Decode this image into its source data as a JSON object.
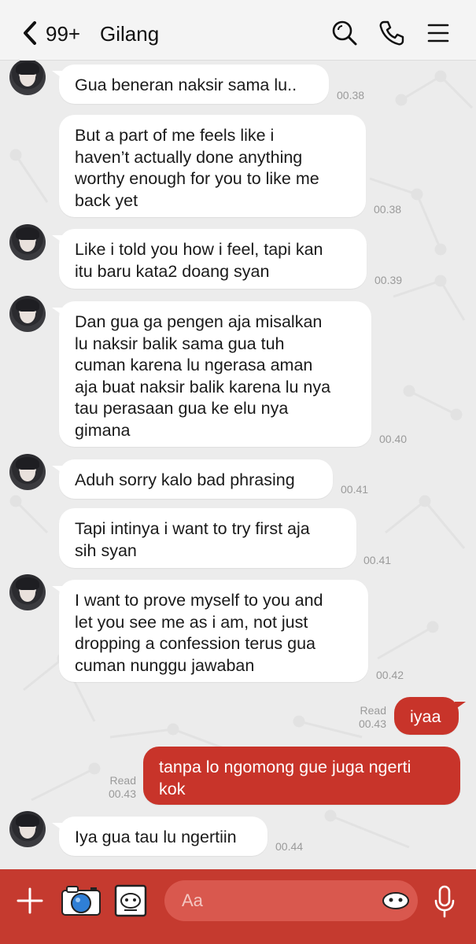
{
  "header": {
    "unread_badge": "99+",
    "contact_name": "Gilang"
  },
  "messages": [
    {
      "from": "other",
      "text": "Gua beneran naksir sama lu..",
      "time": "00.38"
    },
    {
      "from": "other",
      "text": "But a part of me feels like i\nhaven’t actually done anything\nworthy enough for you to like me\nback yet",
      "time": "00.38"
    },
    {
      "from": "other",
      "text": "Like i told you how i feel, tapi kan\nitu baru kata2 doang syan",
      "time": "00.39"
    },
    {
      "from": "other",
      "text": "Dan gua ga pengen aja misalkan\nlu naksir balik sama gua tuh\ncuman karena lu ngerasa aman\naja buat naksir balik karena lu nya\ntau perasaan gua ke elu nya\ngimana",
      "time": "00.40"
    },
    {
      "from": "other",
      "text": "Aduh sorry kalo bad phrasing",
      "time": "00.41"
    },
    {
      "from": "other",
      "text": "Tapi intinya i want to try first aja\nsih syan",
      "time": "00.41"
    },
    {
      "from": "other",
      "text": "I want to prove myself to you and\nlet you see me as i am, not just\ndropping a confession terus gua\ncuman nunggu jawaban",
      "time": "00.42"
    },
    {
      "from": "me",
      "text": "iyaa",
      "status": "Read",
      "time": "00.43"
    },
    {
      "from": "me",
      "text": "tanpa lo ngomong gue juga ngerti\nkok",
      "status": "Read",
      "time": "00.43"
    },
    {
      "from": "other",
      "text": "Iya gua tau lu ngertiin",
      "time": "00.44"
    }
  ],
  "composer": {
    "placeholder": "Aa"
  },
  "colors": {
    "accent": "#c8342a",
    "bottom_bar": "#c53a2f",
    "bubble_other": "#ffffff",
    "chat_bg": "#ececec"
  },
  "icons": {
    "back": "chevron-left-icon",
    "search": "search-icon",
    "call": "phone-icon",
    "menu": "menu-icon",
    "add": "plus-icon",
    "camera": "camera-icon",
    "gallery": "image-sticker-icon",
    "emoji": "emoji-icon",
    "mic": "microphone-icon"
  }
}
